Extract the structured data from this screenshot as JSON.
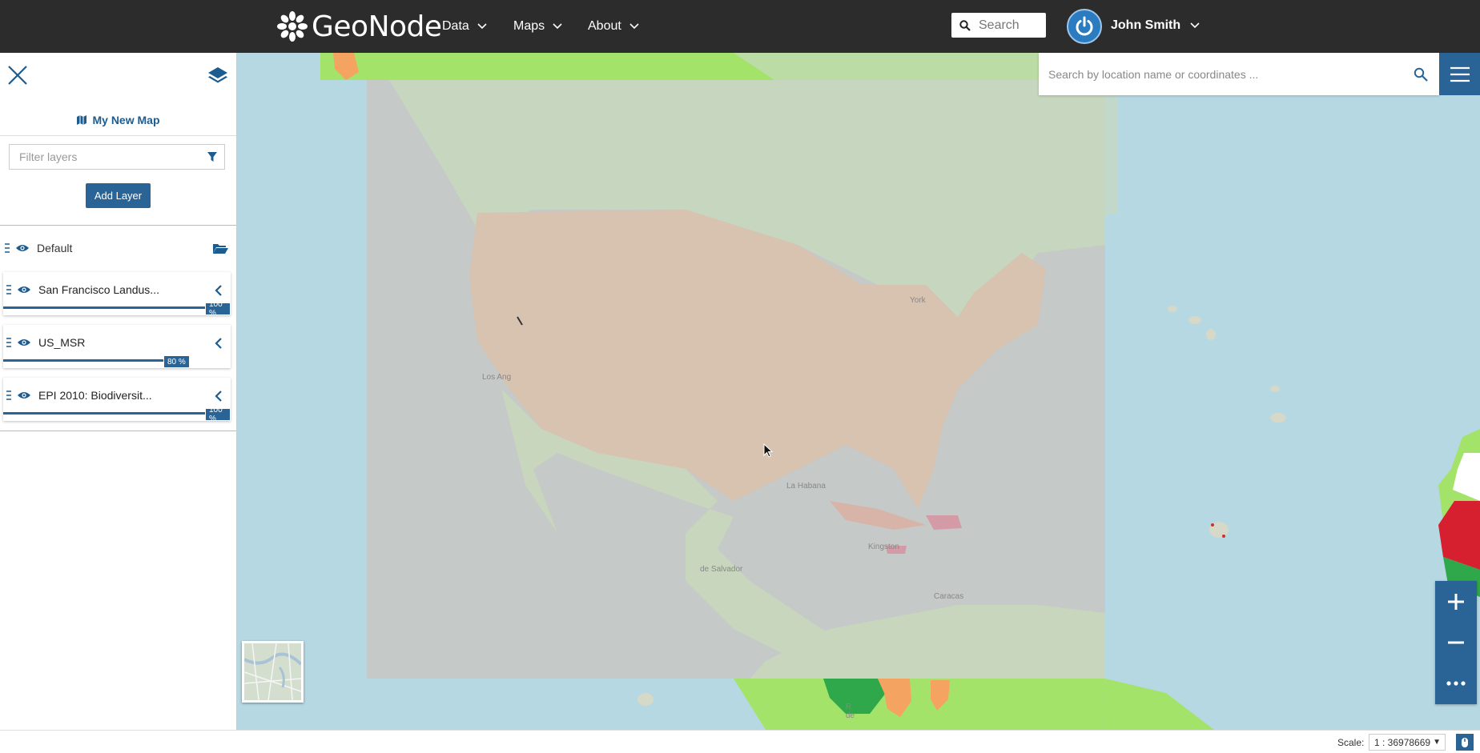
{
  "navbar": {
    "brand": "GeoNode",
    "menu": [
      {
        "label": "Data"
      },
      {
        "label": "Maps"
      },
      {
        "label": "About"
      }
    ],
    "search_placeholder": "Search",
    "user_name": "John Smith"
  },
  "panel": {
    "map_title": "My New Map",
    "filter_placeholder": "Filter layers",
    "add_layer_label": "Add Layer",
    "group_name": "Default",
    "layers": [
      {
        "name": "San Francisco Landus...",
        "opacity": 100,
        "opacity_label": "100 %"
      },
      {
        "name": "US_MSR",
        "opacity": 80,
        "opacity_label": "80 %"
      },
      {
        "name": "EPI 2010: Biodiversit...",
        "opacity": 100,
        "opacity_label": "100 %"
      }
    ]
  },
  "map": {
    "search_placeholder": "Search by location name or coordinates ...",
    "labels": [
      "York",
      "Los Ang",
      "La Habana",
      "Kingston",
      "de Salvador",
      "Caracas",
      "R de"
    ]
  },
  "footer": {
    "scale_label": "Scale:",
    "scale_value": "1 : 36978669"
  },
  "colors": {
    "navbar": "#2c2c2c",
    "accent": "#2a6496",
    "ocean": "#b6d8e3"
  }
}
